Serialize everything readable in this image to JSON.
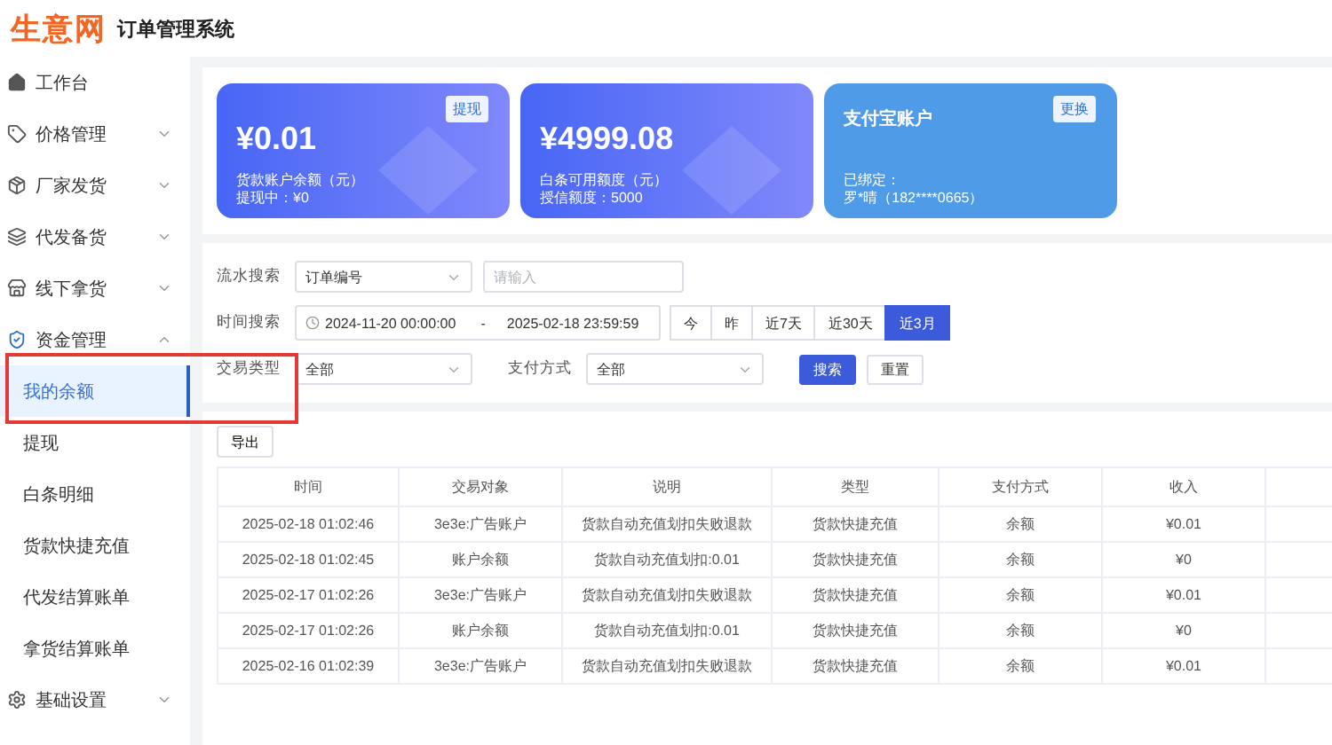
{
  "header": {
    "logo": "生意网",
    "title": "订单管理系统"
  },
  "sidebar": {
    "items": [
      {
        "kind": "link",
        "label": "工作台",
        "selected": false
      },
      {
        "kind": "group",
        "label": "价格管理",
        "expanded": false
      },
      {
        "kind": "group",
        "label": "厂家发货",
        "expanded": false
      },
      {
        "kind": "group",
        "label": "代发备货",
        "expanded": false
      },
      {
        "kind": "group",
        "label": "线下拿货",
        "expanded": false
      },
      {
        "kind": "group",
        "label": "资金管理",
        "expanded": true,
        "children": [
          {
            "label": "我的余额",
            "selected": true
          },
          {
            "label": "提现",
            "selected": false
          },
          {
            "label": "白条明细",
            "selected": false
          },
          {
            "label": "货款快捷充值",
            "selected": false
          },
          {
            "label": "代发结算账单",
            "selected": false
          },
          {
            "label": "拿货结算账单",
            "selected": false
          }
        ]
      },
      {
        "kind": "group",
        "label": "基础设置",
        "expanded": false
      }
    ]
  },
  "cards": [
    {
      "kind": "balance",
      "amount": "¥0.01",
      "button": "提现",
      "lines": [
        "货款账户余额（元）",
        "提现中：¥0"
      ]
    },
    {
      "kind": "balance",
      "amount": "¥4999.08",
      "lines": [
        "白条可用额度（元）",
        "授信额度：5000"
      ]
    },
    {
      "kind": "account",
      "title": "支付宝账户",
      "button": "更换",
      "lines": [
        "已绑定：",
        "罗*晴（182****0665）"
      ]
    }
  ],
  "filters": {
    "flow_search": {
      "label": "流水搜索",
      "select": "订单编号",
      "placeholder": "请输入"
    },
    "time_search": {
      "label": "时间搜索",
      "start": "2024-11-20 00:00:00",
      "separator": "-",
      "end": "2025-02-18 23:59:59",
      "quick": [
        {
          "label": "今",
          "selected": false
        },
        {
          "label": "昨",
          "selected": false
        },
        {
          "label": "近7天",
          "selected": false
        },
        {
          "label": "近30天",
          "selected": false
        },
        {
          "label": "近3月",
          "selected": true
        }
      ]
    },
    "trade_type": {
      "label": "交易类型",
      "value": "全部"
    },
    "pay_method": {
      "label": "支付方式",
      "value": "全部"
    },
    "buttons": [
      {
        "kind": "primary",
        "label": "搜索"
      },
      {
        "kind": "default",
        "label": "重置"
      }
    ]
  },
  "export_button": "导出",
  "table": {
    "columns": [
      "时间",
      "交易对象",
      "说明",
      "类型",
      "支付方式",
      "收入"
    ],
    "rows": [
      [
        "2025-02-18 01:02:46",
        "3e3e:广告账户",
        "货款自动充值划扣失败退款",
        "货款快捷充值",
        "余额",
        "¥0.01"
      ],
      [
        "2025-02-18 01:02:45",
        "账户余额",
        "货款自动充值划扣:0.01",
        "货款快捷充值",
        "余额",
        "¥0"
      ],
      [
        "2025-02-17 01:02:26",
        "3e3e:广告账户",
        "货款自动充值划扣失败退款",
        "货款快捷充值",
        "余额",
        "¥0.01"
      ],
      [
        "2025-02-17 01:02:26",
        "账户余额",
        "货款自动充值划扣:0.01",
        "货款快捷充值",
        "余额",
        "¥0"
      ],
      [
        "2025-02-16 01:02:39",
        "3e3e:广告账户",
        "货款自动充值划扣失败退款",
        "货款快捷充值",
        "余额",
        "¥0.01"
      ]
    ]
  }
}
